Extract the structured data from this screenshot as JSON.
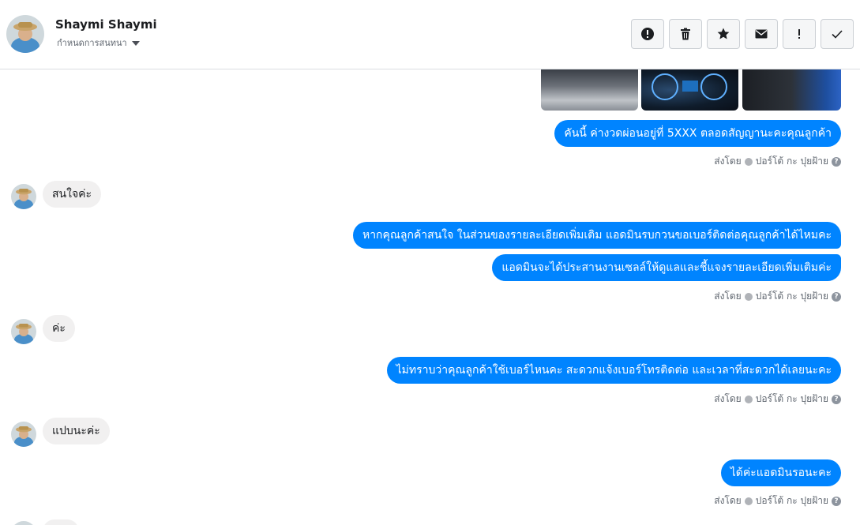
{
  "header": {
    "name": "Shaymi Shaymi",
    "assign_label": "กำหนดการสนทนา"
  },
  "toolbar": {
    "icons": [
      "alert-circle-icon",
      "trash-icon",
      "star-icon",
      "mail-icon",
      "exclamation-icon",
      "check-icon"
    ]
  },
  "messages": {
    "m1": "คันนี้ ค่างวดผ่อนอยู่ที่ 5XXX  ตลอดสัญญานะคะคุณลูกค้า",
    "m2": "สนใจค่ะ",
    "m3": "หากคุณลูกค้าสนใจ ในส่วนของรายละเอียดเพิ่มเติม แอดมินรบกวนขอเบอร์ติดต่อคุณลูกค้าได้ไหมคะ",
    "m4": "แอดมินจะได้ประสานงานเซลล์ให้ดูแลและชี้แจงรายละเอียดเพิ่มเติมค่ะ",
    "m5": "ค่ะ",
    "m6": "ไม่ทราบว่าคุณลูกค้าใช้เบอร์ไหนคะ สะดวกแจ้งเบอร์โทรติดต่อ และเวลาที่สะดวกได้เลยนะคะ",
    "m7": "แปบนะค่ะ",
    "m8": "ได้ค่ะแอดมินรอนะคะ"
  },
  "meta": {
    "sent_by_prefix": "ส่งโดย",
    "sent_by_name": "ปอร์โต้ กะ ปุยฝ้าย",
    "help_glyph": "?"
  }
}
